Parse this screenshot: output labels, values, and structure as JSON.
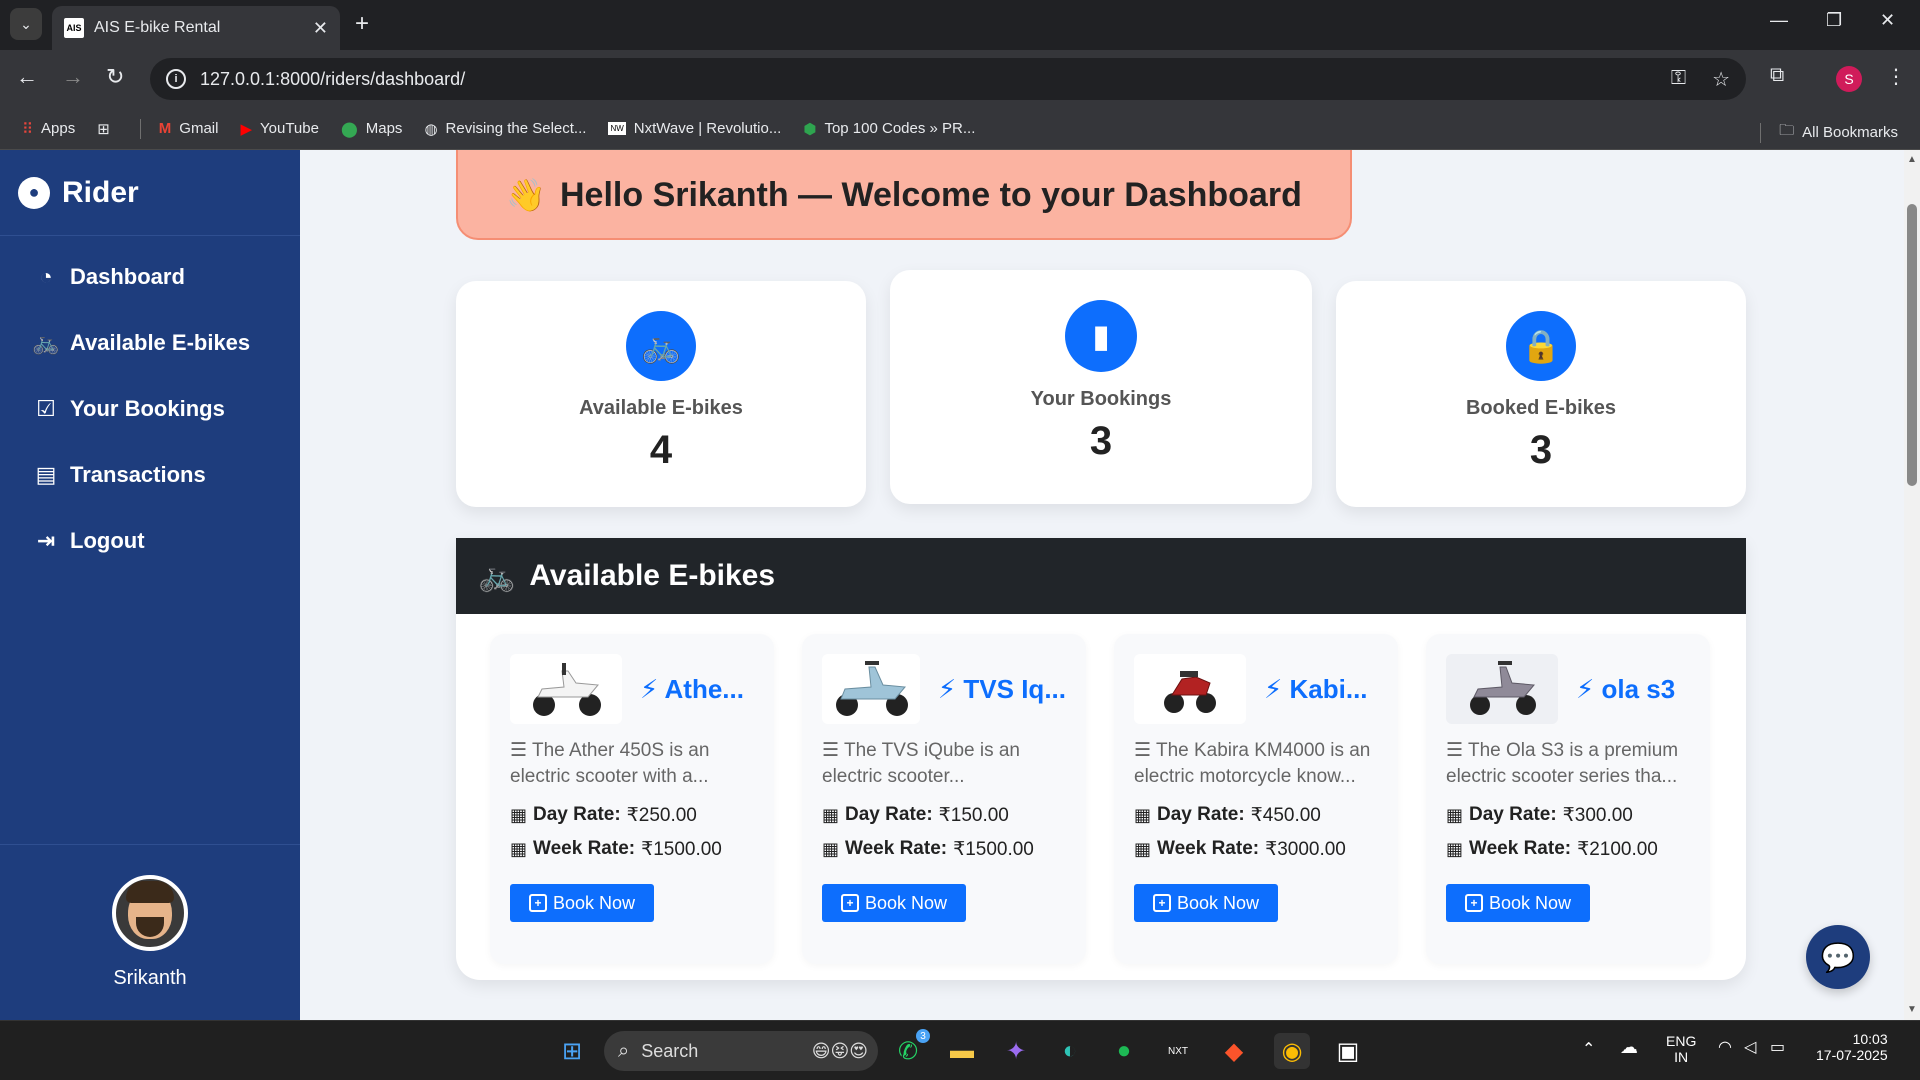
{
  "browser": {
    "tab_title": "AIS E-bike Rental",
    "tab_favicon": "AIS",
    "url": "127.0.0.1:8000/riders/dashboard/",
    "profile_initial": "S",
    "bookmarks": [
      {
        "label": "Apps",
        "icon": "apps-grid-icon"
      },
      {
        "label": "",
        "icon": "tab-groups-icon"
      },
      {
        "label": "Gmail",
        "icon": "gmail-icon"
      },
      {
        "label": "YouTube",
        "icon": "youtube-icon"
      },
      {
        "label": "Maps",
        "icon": "maps-icon"
      },
      {
        "label": "Revising the Select...",
        "icon": "globe-icon"
      },
      {
        "label": "NxtWave | Revolutio...",
        "icon": "nxtwave-icon"
      },
      {
        "label": "Top 100 Codes » PR...",
        "icon": "shield-icon"
      }
    ],
    "all_bookmarks": "All Bookmarks"
  },
  "sidebar": {
    "brand": "Rider",
    "items": [
      {
        "label": "Dashboard",
        "icon": "dashboard-gauge-icon"
      },
      {
        "label": "Available E-bikes",
        "icon": "bicycle-icon"
      },
      {
        "label": "Your Bookings",
        "icon": "calendar-check-icon"
      },
      {
        "label": "Transactions",
        "icon": "receipt-icon"
      },
      {
        "label": "Logout",
        "icon": "logout-icon"
      }
    ],
    "user_name": "Srikanth"
  },
  "greeting": {
    "text": "Hello Srikanth — Welcome to your Dashboard",
    "emoji": "👋"
  },
  "stats": [
    {
      "label": "Available E-bikes",
      "value": "4",
      "icon": "bicycle-icon"
    },
    {
      "label": "Your Bookings",
      "value": "3",
      "icon": "bookmark-icon"
    },
    {
      "label": "Booked E-bikes",
      "value": "3",
      "icon": "lock-icon"
    }
  ],
  "available": {
    "heading": "Available E-bikes",
    "day_rate_label": "Day Rate:",
    "week_rate_label": "Week Rate:",
    "book_label": "Book Now",
    "bikes": [
      {
        "title": "Athe...",
        "desc": "The Ather 450S is an electric scooter with a...",
        "day_rate": "₹250.00",
        "week_rate": "₹1500.00"
      },
      {
        "title": "TVS Iq...",
        "desc": "The TVS iQube is an electric scooter...",
        "day_rate": "₹150.00",
        "week_rate": "₹1500.00"
      },
      {
        "title": "Kabi...",
        "desc": "The Kabira KM4000 is an electric motorcycle know...",
        "day_rate": "₹450.00",
        "week_rate": "₹3000.00"
      },
      {
        "title": "ola s3",
        "desc": "The Ola S3 is a premium electric scooter series tha...",
        "day_rate": "₹300.00",
        "week_rate": "₹2100.00"
      }
    ]
  },
  "taskbar": {
    "search_label": "Search",
    "whatsapp_badge": "3",
    "lang_line1": "ENG",
    "lang_line2": "IN",
    "time": "10:03",
    "date": "17-07-2025"
  },
  "colors": {
    "sidebar_bg": "#1e3d7d",
    "accent": "#0d6efd",
    "greeting_bg": "#fbb3a1",
    "header_dark": "#212529"
  }
}
